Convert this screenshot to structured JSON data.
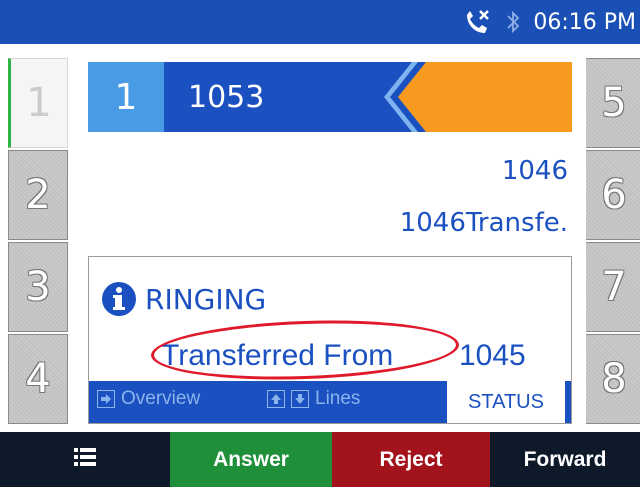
{
  "status_bar": {
    "time": "06:16 PM",
    "icons": [
      "missed-call-icon",
      "bluetooth-icon"
    ]
  },
  "line_keys": {
    "left": [
      "1",
      "2",
      "3",
      "4"
    ],
    "right": [
      "5",
      "6",
      "7",
      "8"
    ],
    "active": "1"
  },
  "line_header": {
    "line_number": "1",
    "extension": "1053"
  },
  "caller": {
    "number": "1046",
    "name": "1046Transfe."
  },
  "status": {
    "icon": "info-icon",
    "state": "RINGING",
    "transfer_label": "Transferred From",
    "transfer_number": "1045"
  },
  "nav": {
    "overview_label": "Overview",
    "lines_label": "Lines",
    "status_tab": "STATUS"
  },
  "softkeys": {
    "menu_icon": "menu-icon",
    "answer": "Answer",
    "reject": "Reject",
    "forward": "Forward"
  },
  "colors": {
    "brand_blue": "#1b50c1",
    "light_blue": "#4a9be6",
    "orange": "#f79a1f",
    "answer_green": "#1f8f3a",
    "reject_red": "#a2131c",
    "highlight_red": "#e0192b",
    "active_line_indicator": "#2fb344"
  }
}
